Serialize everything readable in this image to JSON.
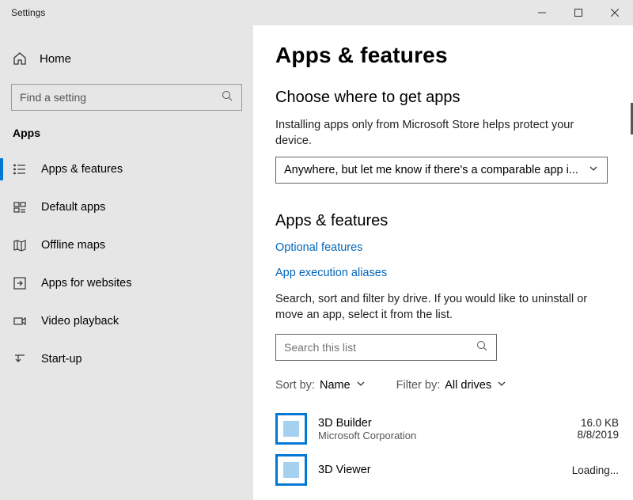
{
  "window": {
    "title": "Settings"
  },
  "sidebar": {
    "home": "Home",
    "search_placeholder": "Find a setting",
    "section": "Apps",
    "items": [
      {
        "label": "Apps & features"
      },
      {
        "label": "Default apps"
      },
      {
        "label": "Offline maps"
      },
      {
        "label": "Apps for websites"
      },
      {
        "label": "Video playback"
      },
      {
        "label": "Start-up"
      }
    ]
  },
  "main": {
    "title": "Apps & features",
    "choose_heading": "Choose where to get apps",
    "choose_desc": "Installing apps only from Microsoft Store helps protect your device.",
    "source_select": "Anywhere, but let me know if there's a comparable app i...",
    "af_heading": "Apps & features",
    "link_optional": "Optional features",
    "link_aliases": "App execution aliases",
    "filter_desc": "Search, sort and filter by drive. If you would like to uninstall or move an app, select it from the list.",
    "search_placeholder": "Search this list",
    "sort_label": "Sort by:",
    "sort_value": "Name",
    "filter_label": "Filter by:",
    "filter_value": "All drives",
    "apps": [
      {
        "name": "3D Builder",
        "publisher": "Microsoft Corporation",
        "size": "16.0 KB",
        "date": "8/8/2019"
      },
      {
        "name": "3D Viewer",
        "publisher": "",
        "size": "Loading...",
        "date": ""
      }
    ]
  }
}
